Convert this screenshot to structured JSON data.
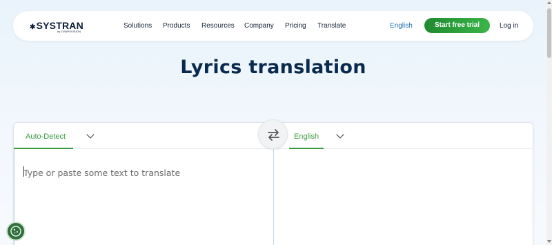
{
  "header": {
    "logo_text": "SYSTRAN",
    "logo_subtext": "by CHAPSVISION",
    "nav": [
      "Solutions",
      "Products",
      "Resources",
      "Company",
      "Pricing",
      "Translate"
    ],
    "language": "English",
    "cta_label": "Start free trial",
    "login_label": "Log in"
  },
  "main": {
    "title": "Lyrics translation",
    "source_language": "Auto-Detect",
    "target_language": "English",
    "input_placeholder": "Type or paste some text to translate"
  },
  "icons": {
    "logo": "systran-star-icon",
    "swap": "swap-arrows-icon",
    "chevron": "chevron-down-icon",
    "cookie": "cookie-icon"
  },
  "colors": {
    "accent_green": "#3a9a3e",
    "cta_gradient_start": "#1f8a2e",
    "cta_gradient_end": "#3bb54a",
    "title_navy": "#0a2a4d",
    "link_blue": "#1f6fb2"
  }
}
